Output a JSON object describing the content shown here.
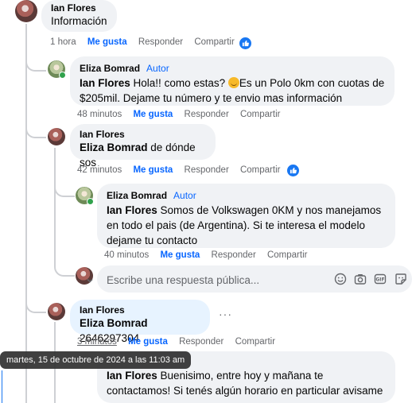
{
  "actions": {
    "like": "Me gusta",
    "reply": "Responder",
    "share": "Compartir"
  },
  "comment1": {
    "author": "Ian Flores",
    "text": "Información",
    "time": "1 hora"
  },
  "reply1": {
    "author": "Eliza Bomrad",
    "badge": "Autor",
    "mention": "Ian Flores",
    "text_a": "Hola!! como estas?",
    "text_b": "Es un Polo 0km con cuotas de $205mil. Dejame tu número y te envio mas información",
    "time": "48 minutos"
  },
  "reply2": {
    "author": "Ian Flores",
    "mention": "Eliza Bomrad",
    "text": "de dónde sos",
    "time": "42 minutos"
  },
  "reply3": {
    "author": "Eliza Bomrad",
    "badge": "Autor",
    "mention": "Ian Flores",
    "text": "Somos de Volkswagen 0KM y nos manejamos en todo el pais (de Argentina). Si te interesa el modelo dejame tu contacto",
    "time": "40 minutos"
  },
  "reply_input": {
    "placeholder": "Escribe una respuesta pública..."
  },
  "reply4": {
    "author": "Ian Flores",
    "mention": "Eliza Bomrad",
    "text": "2646297304",
    "time": "3 minutos"
  },
  "tooltip": {
    "text": "martes, 15 de octubre de 2024 a las 11:03 am"
  },
  "reply5": {
    "mention": "Ian Flores",
    "text": "Buenisimo, entre hoy y mañana te contactamos! Si tenés algún horario en particular avisame"
  },
  "colors": {
    "accent": "#0866ff",
    "bubble": "#f0f2f5",
    "highlight": "#e7f3ff",
    "secondary_text": "#65676b",
    "online": "#31a24c"
  },
  "icons": [
    "like-reaction-icon",
    "emoji-icon",
    "camera-icon",
    "gif-icon",
    "sticker-icon",
    "more-options-icon",
    "online-indicator-icon",
    "chevron-down-icon"
  ]
}
